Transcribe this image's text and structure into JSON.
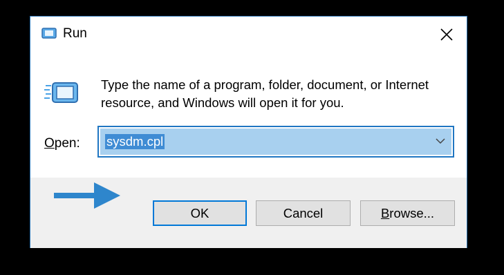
{
  "window": {
    "title": "Run",
    "close_icon": "close-icon",
    "app_icon": "run-icon"
  },
  "body": {
    "description": "Type the name of a program, folder, document, or Internet resource, and Windows will open it for you.",
    "icon": "run-icon"
  },
  "open": {
    "label_underlined": "O",
    "label_rest": "pen:",
    "value": "sysdm.cpl",
    "dropdown_icon": "chevron-down-icon"
  },
  "buttons": {
    "ok": "OK",
    "cancel": "Cancel",
    "browse_underlined": "B",
    "browse_rest": "rowse..."
  },
  "annotation": {
    "arrow_icon": "arrow-right-icon",
    "color": "#2e86cc"
  },
  "colors": {
    "accent": "#0078d7",
    "selection": "#a8d0ef",
    "footer_bg": "#f0f0f0"
  }
}
